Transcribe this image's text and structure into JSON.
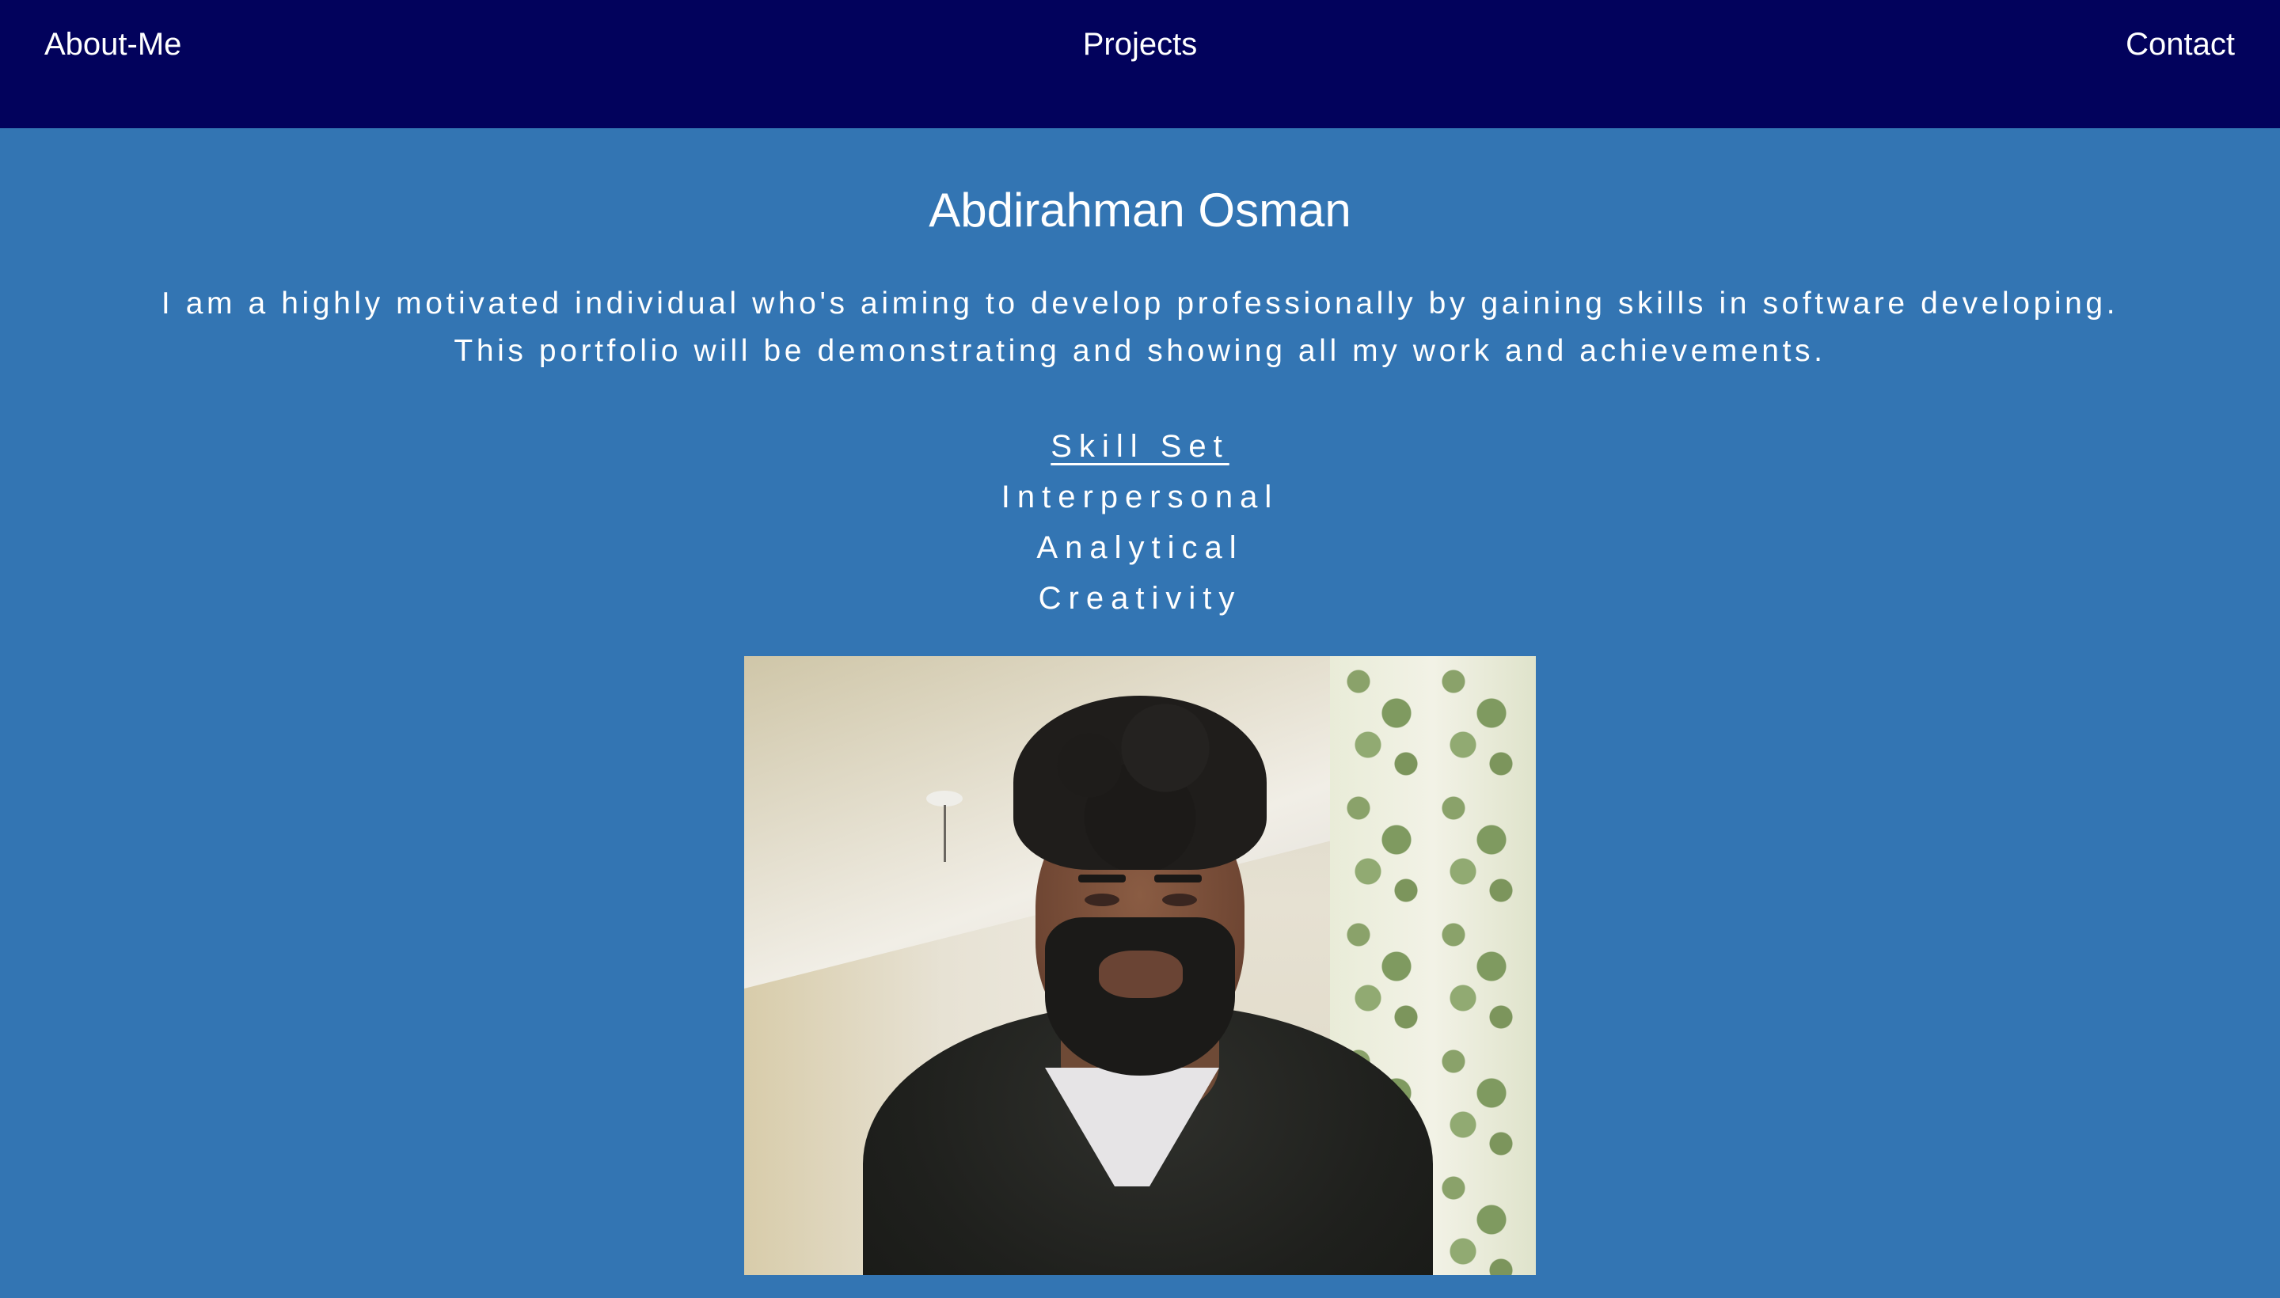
{
  "nav": {
    "about": "About-Me",
    "projects": "Projects",
    "contact": "Contact"
  },
  "profile": {
    "name": "Abdirahman Osman",
    "intro": "I am a highly motivated individual who's aiming to develop professionally by gaining skills in software developing. This portfolio will be demonstrating and showing all my work and achievements."
  },
  "skills": {
    "heading": "Skill Set",
    "items": [
      "Interpersonal",
      "Analytical",
      "Creativity"
    ]
  },
  "photo": {
    "subject": "profile-photo"
  },
  "colors": {
    "navbar": "#02025c",
    "background": "#3375b3",
    "text": "#ffffff"
  }
}
